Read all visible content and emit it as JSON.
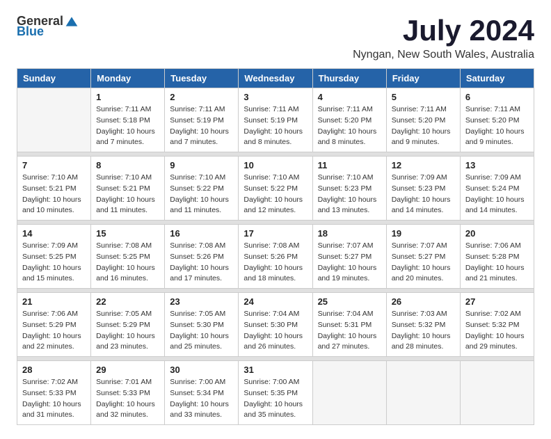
{
  "logo": {
    "general": "General",
    "blue": "Blue"
  },
  "title": "July 2024",
  "subtitle": "Nyngan, New South Wales, Australia",
  "days_of_week": [
    "Sunday",
    "Monday",
    "Tuesday",
    "Wednesday",
    "Thursday",
    "Friday",
    "Saturday"
  ],
  "weeks": [
    [
      {
        "day": "",
        "info": ""
      },
      {
        "day": "1",
        "info": "Sunrise: 7:11 AM\nSunset: 5:18 PM\nDaylight: 10 hours\nand 7 minutes."
      },
      {
        "day": "2",
        "info": "Sunrise: 7:11 AM\nSunset: 5:19 PM\nDaylight: 10 hours\nand 7 minutes."
      },
      {
        "day": "3",
        "info": "Sunrise: 7:11 AM\nSunset: 5:19 PM\nDaylight: 10 hours\nand 8 minutes."
      },
      {
        "day": "4",
        "info": "Sunrise: 7:11 AM\nSunset: 5:20 PM\nDaylight: 10 hours\nand 8 minutes."
      },
      {
        "day": "5",
        "info": "Sunrise: 7:11 AM\nSunset: 5:20 PM\nDaylight: 10 hours\nand 9 minutes."
      },
      {
        "day": "6",
        "info": "Sunrise: 7:11 AM\nSunset: 5:20 PM\nDaylight: 10 hours\nand 9 minutes."
      }
    ],
    [
      {
        "day": "7",
        "info": "Sunrise: 7:10 AM\nSunset: 5:21 PM\nDaylight: 10 hours\nand 10 minutes."
      },
      {
        "day": "8",
        "info": "Sunrise: 7:10 AM\nSunset: 5:21 PM\nDaylight: 10 hours\nand 11 minutes."
      },
      {
        "day": "9",
        "info": "Sunrise: 7:10 AM\nSunset: 5:22 PM\nDaylight: 10 hours\nand 11 minutes."
      },
      {
        "day": "10",
        "info": "Sunrise: 7:10 AM\nSunset: 5:22 PM\nDaylight: 10 hours\nand 12 minutes."
      },
      {
        "day": "11",
        "info": "Sunrise: 7:10 AM\nSunset: 5:23 PM\nDaylight: 10 hours\nand 13 minutes."
      },
      {
        "day": "12",
        "info": "Sunrise: 7:09 AM\nSunset: 5:23 PM\nDaylight: 10 hours\nand 14 minutes."
      },
      {
        "day": "13",
        "info": "Sunrise: 7:09 AM\nSunset: 5:24 PM\nDaylight: 10 hours\nand 14 minutes."
      }
    ],
    [
      {
        "day": "14",
        "info": "Sunrise: 7:09 AM\nSunset: 5:25 PM\nDaylight: 10 hours\nand 15 minutes."
      },
      {
        "day": "15",
        "info": "Sunrise: 7:08 AM\nSunset: 5:25 PM\nDaylight: 10 hours\nand 16 minutes."
      },
      {
        "day": "16",
        "info": "Sunrise: 7:08 AM\nSunset: 5:26 PM\nDaylight: 10 hours\nand 17 minutes."
      },
      {
        "day": "17",
        "info": "Sunrise: 7:08 AM\nSunset: 5:26 PM\nDaylight: 10 hours\nand 18 minutes."
      },
      {
        "day": "18",
        "info": "Sunrise: 7:07 AM\nSunset: 5:27 PM\nDaylight: 10 hours\nand 19 minutes."
      },
      {
        "day": "19",
        "info": "Sunrise: 7:07 AM\nSunset: 5:27 PM\nDaylight: 10 hours\nand 20 minutes."
      },
      {
        "day": "20",
        "info": "Sunrise: 7:06 AM\nSunset: 5:28 PM\nDaylight: 10 hours\nand 21 minutes."
      }
    ],
    [
      {
        "day": "21",
        "info": "Sunrise: 7:06 AM\nSunset: 5:29 PM\nDaylight: 10 hours\nand 22 minutes."
      },
      {
        "day": "22",
        "info": "Sunrise: 7:05 AM\nSunset: 5:29 PM\nDaylight: 10 hours\nand 23 minutes."
      },
      {
        "day": "23",
        "info": "Sunrise: 7:05 AM\nSunset: 5:30 PM\nDaylight: 10 hours\nand 25 minutes."
      },
      {
        "day": "24",
        "info": "Sunrise: 7:04 AM\nSunset: 5:30 PM\nDaylight: 10 hours\nand 26 minutes."
      },
      {
        "day": "25",
        "info": "Sunrise: 7:04 AM\nSunset: 5:31 PM\nDaylight: 10 hours\nand 27 minutes."
      },
      {
        "day": "26",
        "info": "Sunrise: 7:03 AM\nSunset: 5:32 PM\nDaylight: 10 hours\nand 28 minutes."
      },
      {
        "day": "27",
        "info": "Sunrise: 7:02 AM\nSunset: 5:32 PM\nDaylight: 10 hours\nand 29 minutes."
      }
    ],
    [
      {
        "day": "28",
        "info": "Sunrise: 7:02 AM\nSunset: 5:33 PM\nDaylight: 10 hours\nand 31 minutes."
      },
      {
        "day": "29",
        "info": "Sunrise: 7:01 AM\nSunset: 5:33 PM\nDaylight: 10 hours\nand 32 minutes."
      },
      {
        "day": "30",
        "info": "Sunrise: 7:00 AM\nSunset: 5:34 PM\nDaylight: 10 hours\nand 33 minutes."
      },
      {
        "day": "31",
        "info": "Sunrise: 7:00 AM\nSunset: 5:35 PM\nDaylight: 10 hours\nand 35 minutes."
      },
      {
        "day": "",
        "info": ""
      },
      {
        "day": "",
        "info": ""
      },
      {
        "day": "",
        "info": ""
      }
    ]
  ]
}
